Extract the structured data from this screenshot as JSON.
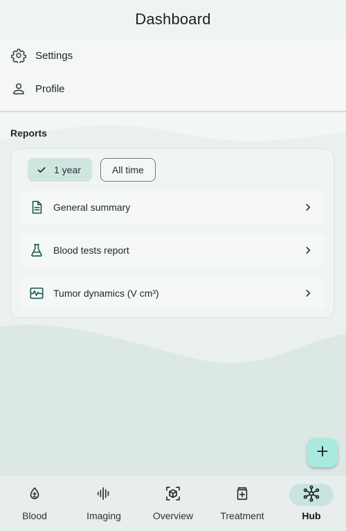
{
  "header": {
    "title": "Dashboard"
  },
  "menu": {
    "items": [
      {
        "label": "Settings",
        "icon": "gear-icon"
      },
      {
        "label": "Profile",
        "icon": "person-icon"
      }
    ]
  },
  "reports": {
    "title": "Reports",
    "filters": [
      {
        "label": "1 year",
        "selected": true
      },
      {
        "label": "All time",
        "selected": false
      }
    ],
    "items": [
      {
        "label": "General summary",
        "icon": "document-icon"
      },
      {
        "label": "Blood tests report",
        "icon": "flask-icon"
      },
      {
        "label": "Tumor dynamics (V cm³)",
        "icon": "monitor-waveform-icon"
      }
    ]
  },
  "fab": {
    "icon": "plus-icon"
  },
  "bottom_nav": {
    "items": [
      {
        "label": "Blood",
        "icon": "blood-drop-icon",
        "active": false
      },
      {
        "label": "Imaging",
        "icon": "waveform-icon",
        "active": false
      },
      {
        "label": "Overview",
        "icon": "cube-scan-icon",
        "active": false
      },
      {
        "label": "Treatment",
        "icon": "medication-icon",
        "active": false
      },
      {
        "label": "Hub",
        "icon": "network-hub-icon",
        "active": true
      }
    ]
  },
  "colors": {
    "accent": "#1f5b52",
    "selected_chip": "#cfe5e0",
    "fab": "#a9eadf",
    "nav_active_pill": "#c9e4de"
  }
}
